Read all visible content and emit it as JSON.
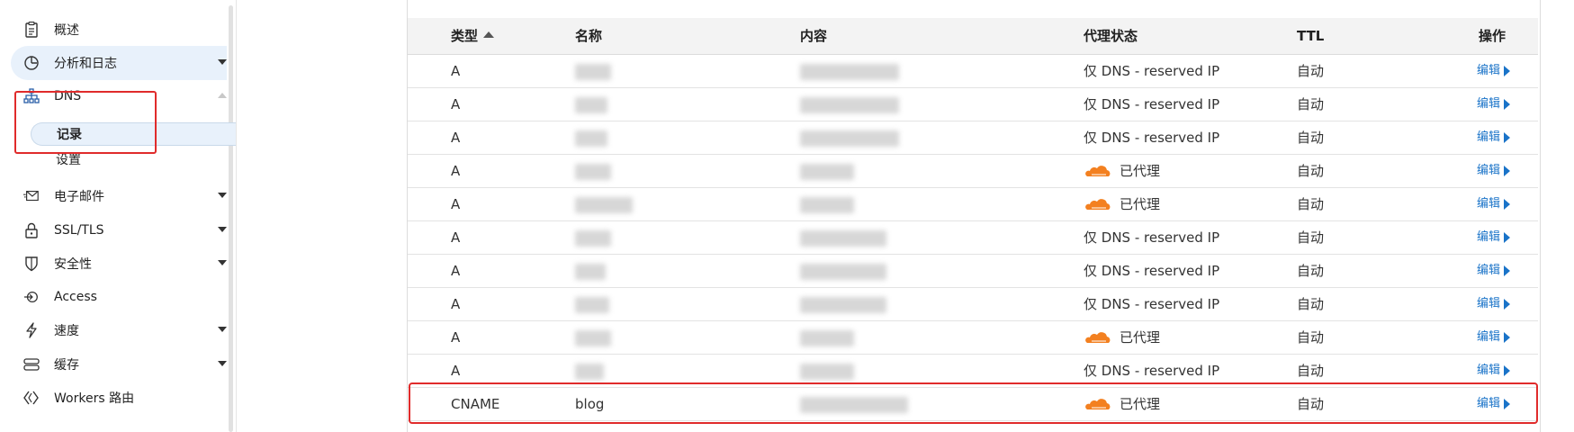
{
  "sidebar": {
    "items": [
      {
        "label": "概述",
        "icon": "document-icon"
      },
      {
        "label": "分析和日志",
        "icon": "pie-chart-icon"
      },
      {
        "label": "DNS",
        "icon": "network-tree-icon"
      },
      {
        "label": "电子邮件",
        "icon": "email-icon"
      },
      {
        "label": "SSL/TLS",
        "icon": "lock-icon"
      },
      {
        "label": "安全性",
        "icon": "shield-icon"
      },
      {
        "label": "Access",
        "icon": "access-icon"
      },
      {
        "label": "速度",
        "icon": "lightning-icon"
      },
      {
        "label": "缓存",
        "icon": "storage-icon"
      },
      {
        "label": "Workers 路由",
        "icon": "workers-icon"
      }
    ],
    "dns_sub": [
      {
        "label": "记录"
      },
      {
        "label": "设置"
      }
    ]
  },
  "table": {
    "headers": {
      "type": "类型",
      "name": "名称",
      "content": "内容",
      "proxy": "代理状态",
      "ttl": "TTL",
      "action": "操作"
    },
    "rows": [
      {
        "type": "A",
        "name": "",
        "content": "",
        "proxy": "仅 DNS - reserved IP",
        "proxied": false,
        "ttl": "自动",
        "action": "编辑"
      },
      {
        "type": "A",
        "name": "",
        "content": "",
        "proxy": "仅 DNS - reserved IP",
        "proxied": false,
        "ttl": "自动",
        "action": "编辑"
      },
      {
        "type": "A",
        "name": "",
        "content": "",
        "proxy": "仅 DNS - reserved IP",
        "proxied": false,
        "ttl": "自动",
        "action": "编辑"
      },
      {
        "type": "A",
        "name": "",
        "content": "",
        "proxy": "已代理",
        "proxied": true,
        "ttl": "自动",
        "action": "编辑"
      },
      {
        "type": "A",
        "name": "",
        "content": "",
        "proxy": "已代理",
        "proxied": true,
        "ttl": "自动",
        "action": "编辑"
      },
      {
        "type": "A",
        "name": "",
        "content": "",
        "proxy": "仅 DNS - reserved IP",
        "proxied": false,
        "ttl": "自动",
        "action": "编辑"
      },
      {
        "type": "A",
        "name": "",
        "content": "",
        "proxy": "仅 DNS - reserved IP",
        "proxied": false,
        "ttl": "自动",
        "action": "编辑"
      },
      {
        "type": "A",
        "name": "",
        "content": "",
        "proxy": "仅 DNS - reserved IP",
        "proxied": false,
        "ttl": "自动",
        "action": "编辑"
      },
      {
        "type": "A",
        "name": "",
        "content": "",
        "proxy": "已代理",
        "proxied": true,
        "ttl": "自动",
        "action": "编辑"
      },
      {
        "type": "A",
        "name": "",
        "content": "",
        "proxy": "仅 DNS - reserved IP",
        "proxied": false,
        "ttl": "自动",
        "action": "编辑"
      },
      {
        "type": "CNAME",
        "name": "blog",
        "content": "",
        "proxy": "已代理",
        "proxied": true,
        "ttl": "自动",
        "action": "编辑"
      }
    ]
  },
  "colors": {
    "accent": "#1a73c8",
    "highlight": "#e02b2b",
    "cloud": "#f38020",
    "active_bg": "#e8f1fb"
  }
}
